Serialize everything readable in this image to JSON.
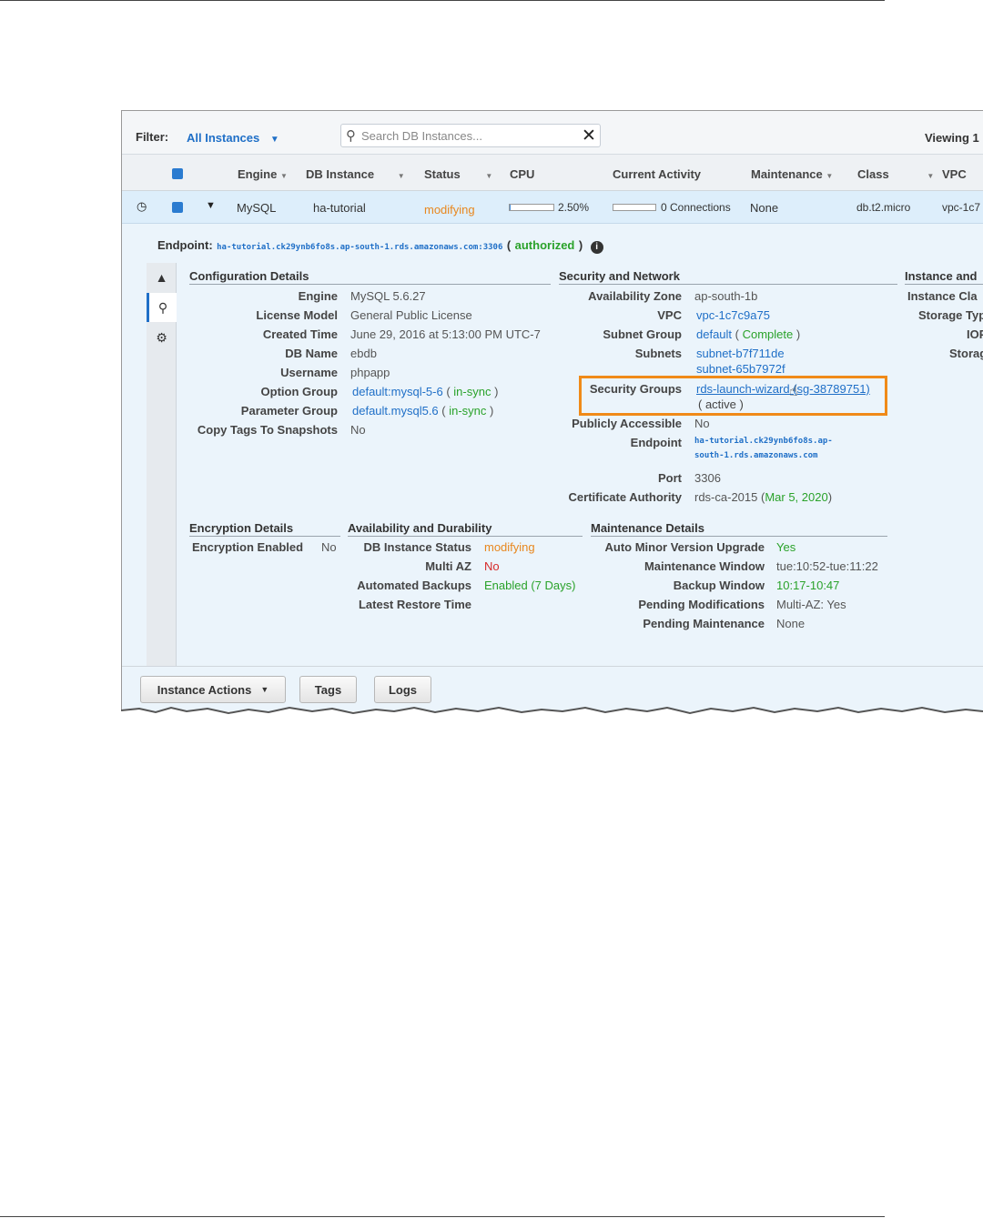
{
  "filter": {
    "label": "Filter:",
    "value": "All Instances",
    "search_placeholder": "Search DB Instances...",
    "viewing": "Viewing 1"
  },
  "columns": [
    "Engine",
    "DB Instance",
    "Status",
    "CPU",
    "Current Activity",
    "Maintenance",
    "Class",
    "VPC"
  ],
  "instance_row": {
    "engine": "MySQL",
    "db_instance": "ha-tutorial",
    "status": "modifying",
    "cpu": "2.50%",
    "cpu_fraction": 0.025,
    "activity": "0 Connections",
    "maintenance": "None",
    "class": "db.t2.micro",
    "vpc": "vpc-1c7"
  },
  "endpoint": {
    "label": "Endpoint:",
    "value": "ha-tutorial.ck29ynb6fo8s.ap-south-1.rds.amazonaws.com:3306",
    "status_open": "(",
    "status": "authorized",
    "status_close": ")"
  },
  "config": {
    "title": "Configuration Details",
    "engine_l": "Engine",
    "engine_v": "MySQL 5.6.27",
    "license_l": "License Model",
    "license_v": "General Public License",
    "created_l": "Created Time",
    "created_v": "June 29, 2016 at 5:13:00 PM UTC-7",
    "dbname_l": "DB Name",
    "dbname_v": "ebdb",
    "user_l": "Username",
    "user_v": "phpapp",
    "optgroup_l": "Option Group",
    "optgroup_v": "default:mysql-5-6",
    "optgroup_s": "in-sync",
    "paramgroup_l": "Parameter Group",
    "paramgroup_v": "default.mysql5.6",
    "paramgroup_s": "in-sync",
    "copytags_l": "Copy Tags To Snapshots",
    "copytags_v": "No"
  },
  "security": {
    "title": "Security and Network",
    "az_l": "Availability Zone",
    "az_v": "ap-south-1b",
    "vpc_l": "VPC",
    "vpc_v": "vpc-1c7c9a75",
    "subnetgroup_l": "Subnet Group",
    "subnetgroup_v": "default",
    "subnetgroup_s": "Complete",
    "subnets_l": "Subnets",
    "subnet1": "subnet-b7f711de",
    "subnet2": "subnet-65b7972f",
    "sg_l": "Security Groups",
    "sg_v": "rds-launch-wizard (sg-38789751)",
    "sg_s": "( active )",
    "public_l": "Publicly Accessible",
    "public_v": "No",
    "endpoint_l": "Endpoint",
    "endpoint_v1": "ha-tutorial.ck29ynb6fo8s.ap-",
    "endpoint_v2": "south-1.rds.amazonaws.com",
    "port_l": "Port",
    "port_v": "3306",
    "cert_l": "Certificate Authority",
    "cert_v": "rds-ca-2015",
    "cert_d": "Mar 5, 2020"
  },
  "instance_class": {
    "title": "Instance and",
    "class_l": "Instance Cla",
    "storage_l": "Storage Typ",
    "iops_l": "IOP",
    "storage2_l": "Storag"
  },
  "encryption": {
    "title": "Encryption Details",
    "enabled_l": "Encryption Enabled",
    "enabled_v": "No"
  },
  "availability": {
    "title": "Availability and Durability",
    "status_l": "DB Instance Status",
    "status_v": "modifying",
    "multiaz_l": "Multi AZ",
    "multiaz_v": "No",
    "backups_l": "Automated Backups",
    "backups_v": "Enabled (7 Days)",
    "restore_l": "Latest Restore Time"
  },
  "maintenance": {
    "title": "Maintenance Details",
    "auto_l": "Auto Minor Version Upgrade",
    "auto_v": "Yes",
    "window_l": "Maintenance Window",
    "window_v": "tue:10:52-tue:11:22",
    "backup_l": "Backup Window",
    "backup_v": "10:17-10:47",
    "pendmod_l": "Pending Modifications",
    "pendmod_v": "Multi-AZ: Yes",
    "pendmaint_l": "Pending Maintenance",
    "pendmaint_v": "None"
  },
  "buttons": {
    "actions": "Instance Actions",
    "tags": "Tags",
    "logs": "Logs"
  },
  "icons": {
    "dropdown": "chevron-down-icon",
    "search": "search-icon",
    "clear": "close-icon",
    "sidebar": [
      "monitoring-icon",
      "details-icon",
      "topology-icon"
    ]
  },
  "colors": {
    "link": "#1f6fc7",
    "ok": "#2aa22a",
    "warn": "#e8871e",
    "error": "#d62a2a",
    "highlight": "#f08a18"
  }
}
